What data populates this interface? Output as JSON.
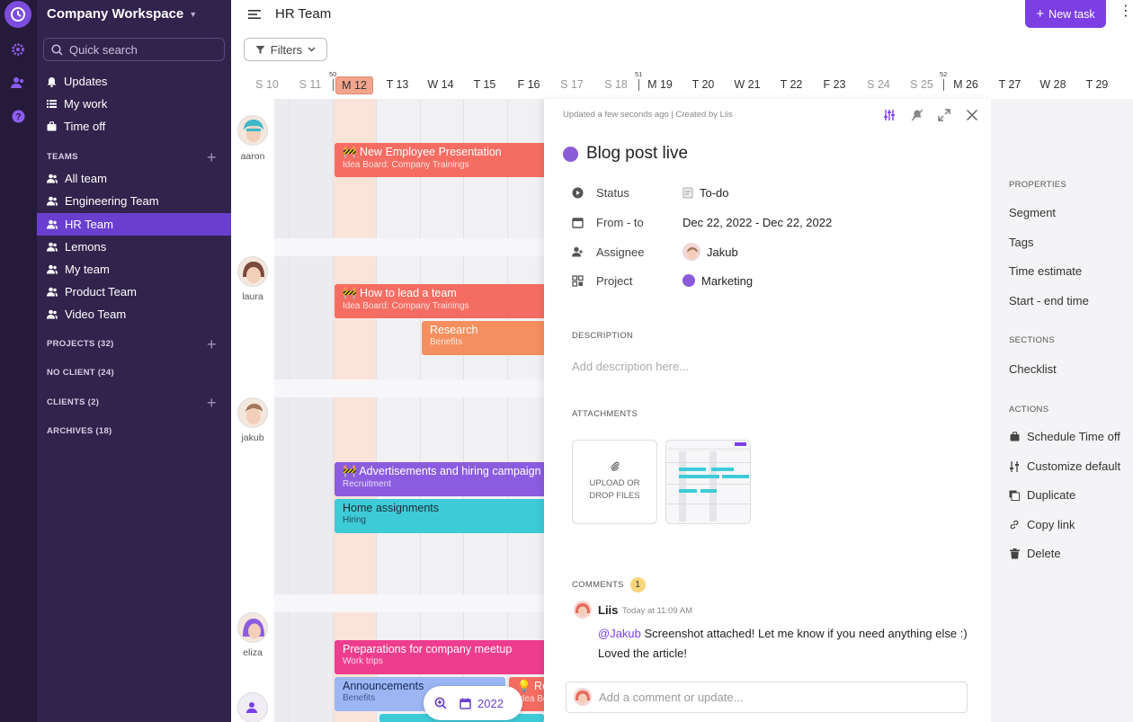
{
  "workspace": {
    "name": "Company Workspace"
  },
  "search": {
    "placeholder": "Quick search"
  },
  "nav": [
    {
      "label": "Updates",
      "icon": "bell-icon"
    },
    {
      "label": "My work",
      "icon": "list-icon"
    },
    {
      "label": "Time off",
      "icon": "briefcase-icon"
    }
  ],
  "teams": {
    "title": "TEAMS",
    "items": [
      {
        "label": "All team"
      },
      {
        "label": "Engineering Team"
      },
      {
        "label": "HR Team",
        "active": true
      },
      {
        "label": "Lemons"
      },
      {
        "label": "My team"
      },
      {
        "label": "Product Team"
      },
      {
        "label": "Video Team"
      }
    ]
  },
  "sections": {
    "projects": "PROJECTS (32)",
    "no_client": "NO CLIENT (24)",
    "clients": "CLIENTS (2)",
    "archives": "ARCHIVES (18)"
  },
  "header": {
    "title": "HR Team",
    "new_task": "New task",
    "filters": "Filters"
  },
  "calendar": {
    "days": [
      {
        "label": "S 10",
        "weekend": true
      },
      {
        "label": "S 11",
        "weekend": true
      },
      {
        "label": "M 12",
        "today": true
      },
      {
        "label": "T 13"
      },
      {
        "label": "W 14"
      },
      {
        "label": "T 15"
      },
      {
        "label": "F 16"
      },
      {
        "label": "S 17",
        "weekend": true
      },
      {
        "label": "S 18",
        "weekend": true
      },
      {
        "label": "M 19"
      },
      {
        "label": "T 20"
      },
      {
        "label": "W 21"
      },
      {
        "label": "T 22"
      },
      {
        "label": "F 23"
      },
      {
        "label": "S 24",
        "weekend": true
      },
      {
        "label": "S 25",
        "weekend": true
      },
      {
        "label": "M 26"
      },
      {
        "label": "T 27"
      },
      {
        "label": "W 28"
      },
      {
        "label": "T 29"
      }
    ],
    "weeks": [
      "50",
      "51",
      "52"
    ]
  },
  "people": [
    {
      "name": "aaron"
    },
    {
      "name": "laura"
    },
    {
      "name": "jakub"
    },
    {
      "name": "eliza"
    }
  ],
  "tasks": [
    {
      "title": "🚧 New Employee Presentation",
      "sub": "Idea Board: Company Trainings",
      "color": "#f56d62"
    },
    {
      "title": "🚧 How to lead a team",
      "sub": "Idea Board: Company Trainings",
      "color": "#f56d62"
    },
    {
      "title": "Research",
      "sub": "Benefits",
      "color": "#f68f5f"
    },
    {
      "title": "🚧 Advertisements and hiring campaign",
      "sub": "Recruitment",
      "color": "#8c5ce0"
    },
    {
      "title": "Home assignments",
      "sub": "Hiring",
      "color": "#3ecbd8"
    },
    {
      "title": "Preparations for company meetup",
      "sub": "Work trips",
      "color": "#ee3d8e"
    },
    {
      "title": "Announcements",
      "sub": "Benefits",
      "color": "#9bb6f3"
    },
    {
      "title": "💡 Re",
      "sub": "Idea Bo",
      "color": "#f56d62"
    }
  ],
  "zoom": {
    "year": "2022"
  },
  "detail": {
    "meta_prefix": "Updated a few seconds ago | Created by ",
    "meta_author": "Liis",
    "title": "Blog post live",
    "title_color": "#8a5cd9",
    "props": [
      {
        "label": "Status",
        "value": "To-do",
        "icon": "status-icon"
      },
      {
        "label": "From - to",
        "value": "Dec 22, 2022 - Dec 22, 2022",
        "icon": "calendar-icon"
      },
      {
        "label": "Assignee",
        "value": "Jakub",
        "icon": "assignee-icon"
      },
      {
        "label": "Project",
        "value": "Marketing",
        "icon": "project-icon"
      }
    ],
    "description_head": "DESCRIPTION",
    "description_placeholder": "Add description here...",
    "attachments_head": "ATTACHMENTS",
    "upload_label": "UPLOAD OR DROP FILES",
    "comments_head": "COMMENTS",
    "comments_count": "1",
    "comment": {
      "author": "Liis",
      "time": "Today at 11:09 AM",
      "mention": "@Jakub",
      "text": " Screenshot attached! Let me know if you need anything else :)",
      "text2": "Loved the article!"
    },
    "comment_placeholder": "Add a comment or update..."
  },
  "right": {
    "properties_head": "PROPERTIES",
    "properties": [
      "Segment",
      "Tags",
      "Time estimate",
      "Start - end time"
    ],
    "sections_head": "SECTIONS",
    "sections": [
      "Checklist"
    ],
    "actions_head": "ACTIONS",
    "actions": [
      {
        "label": "Schedule Time off",
        "icon": "briefcase-icon"
      },
      {
        "label": "Customize default",
        "icon": "sliders-icon"
      },
      {
        "label": "Duplicate",
        "icon": "duplicate-icon"
      },
      {
        "label": "Copy link",
        "icon": "link-icon"
      },
      {
        "label": "Delete",
        "icon": "trash-icon"
      }
    ]
  }
}
